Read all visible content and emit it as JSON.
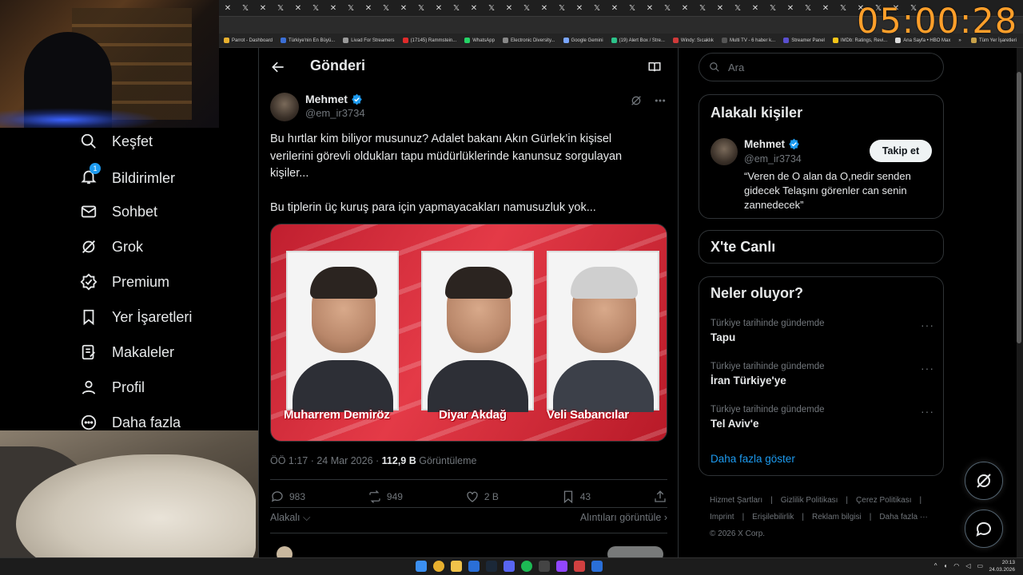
{
  "browser": {
    "timer": "05:00:28",
    "bookmarks": [
      {
        "label": "Parrot - Dashboard",
        "color": "#e8b02e"
      },
      {
        "label": "Türkiye'nin En Büyü...",
        "color": "#3b6fd6"
      },
      {
        "label": "Livad For Streamers",
        "color": "#9a9a9a"
      },
      {
        "label": "(17145) Rammstein...",
        "color": "#e02b2b"
      },
      {
        "label": "WhatsApp",
        "color": "#25d366"
      },
      {
        "label": "Electronic Diversity...",
        "color": "#888888"
      },
      {
        "label": "Google Gemini",
        "color": "#7aa6ff"
      },
      {
        "label": "(19) Alert Box / Stre...",
        "color": "#2cc38a"
      },
      {
        "label": "Windy: Sıcaklık",
        "color": "#d03a3a"
      },
      {
        "label": "Multi TV - 6 haber k...",
        "color": "#555555"
      },
      {
        "label": "Streamer Panel",
        "color": "#5a4fd0"
      },
      {
        "label": "IMDb: Ratings, Revi...",
        "color": "#f5c518"
      },
      {
        "label": "Ana Sayfa • HBO Max",
        "color": "#dddddd"
      }
    ],
    "bookmarks_overflow": "»",
    "bookmarks_all": "Tüm Yer İşaretleri"
  },
  "nav": {
    "items": [
      {
        "label": "Keşfet",
        "icon": "search-icon"
      },
      {
        "label": "Bildirimler",
        "icon": "bell-icon",
        "badge": "1"
      },
      {
        "label": "Sohbet",
        "icon": "mail-icon"
      },
      {
        "label": "Grok",
        "icon": "grok-icon"
      },
      {
        "label": "Premium",
        "icon": "verified-badge-icon"
      },
      {
        "label": "Yer İşaretleri",
        "icon": "bookmark-icon"
      },
      {
        "label": "Makaleler",
        "icon": "article-icon"
      },
      {
        "label": "Profil",
        "icon": "profile-icon"
      },
      {
        "label": "Daha fazla",
        "icon": "more-circle-icon"
      }
    ]
  },
  "post": {
    "header_title": "Gönderi",
    "author_name": "Mehmet",
    "author_handle": "@em_ir3734",
    "text_p1": "Bu hırtlar kim biliyor musunuz? Adalet bakanı Akın Gürlek’in kişisel verilerini görevli oldukları tapu müdürlüklerinde kanunsuz sorgulayan kişiler...",
    "text_p2": "Bu tiplerin üç kuruş para için yapmayacakları namusuzluk yok...",
    "image_captions": [
      "Muharrem Demiröz",
      "Diyar Akdağ",
      "Veli Sabancılar"
    ],
    "time": "ÖÖ 1:17 · 24 Mar 2026 · ",
    "views": "112,9 B",
    "views_label": " Görüntüleme",
    "replies": "983",
    "reposts": "949",
    "likes": "2 B",
    "bookmarks": "43",
    "sort_label": "Alakalı",
    "quotes_link": "Alıntıları görüntüle"
  },
  "sidebar": {
    "search_placeholder": "Ara",
    "related_title": "Alakalı kişiler",
    "related_name": "Mehmet",
    "related_handle": "@em_ir3734",
    "follow_label": "Takip et",
    "related_bio": "“Veren de O alan da O,nedir senden gidecek Telaşını görenler can senin zannedecek”",
    "live_title": "X'te Canlı",
    "trends_title": "Neler oluyor?",
    "trends": [
      {
        "context": "Türkiye tarihinde gündemde",
        "topic": "Tapu"
      },
      {
        "context": "Türkiye tarihinde gündemde",
        "topic": "İran Türkiye'ye"
      },
      {
        "context": "Türkiye tarihinde gündemde",
        "topic": "Tel Aviv'e"
      }
    ],
    "show_more": "Daha fazla göster",
    "footer_links": [
      "Hizmet Şartları",
      "|",
      "Gizlilik Politikası",
      "|",
      "Çerez Politikası",
      "|",
      "Imprint",
      "|",
      "Erişilebilirlik",
      "|",
      "Reklam bilgisi",
      "|",
      "Daha fazla ···"
    ],
    "copyright": "© 2026 X Corp."
  },
  "taskbar": {
    "time": "20:13",
    "date": "24.03.2026"
  }
}
